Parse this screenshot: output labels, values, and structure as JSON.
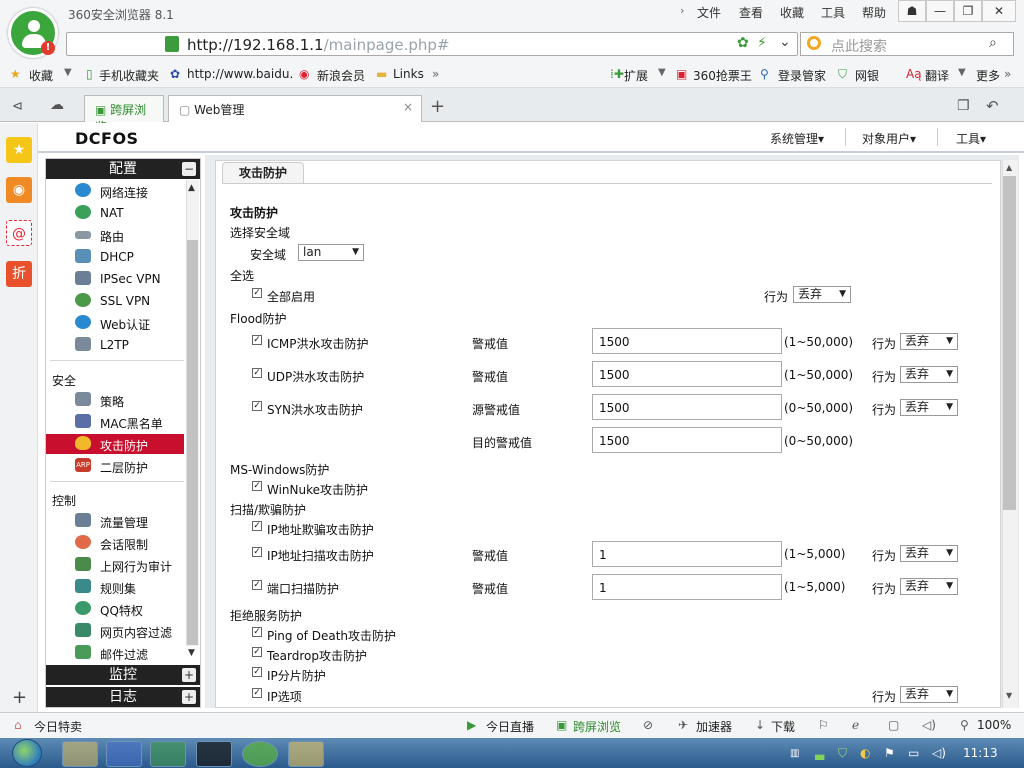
{
  "window": {
    "app_title": "360安全浏览器 8.1",
    "menus": [
      "文件",
      "查看",
      "收藏",
      "工具",
      "帮助"
    ],
    "min_glyph": "—",
    "max_glyph": "❐",
    "close_glyph": "✕"
  },
  "address_bar": {
    "url_host": "http://192.168.1.1",
    "url_path": "/mainpage.php#",
    "search_placeholder": "点此搜索"
  },
  "bookmarks": {
    "items": [
      "收藏",
      "手机收藏夹",
      "http://www.baidu.",
      "新浪会员",
      "Links"
    ],
    "right_items": [
      "扩展",
      "360抢票王",
      "登录管家",
      "网银",
      "翻译",
      "更多"
    ]
  },
  "tabs": {
    "items": [
      "跨屏浏览",
      "Web管理"
    ]
  },
  "app": {
    "logo": "DCFOS",
    "menus": [
      "系统管理▾",
      "对象用户▾",
      "工具▾"
    ]
  },
  "nav": {
    "sections": {
      "config": "配置",
      "monitor": "监控",
      "log": "日志"
    },
    "config_items": [
      "网络连接",
      "NAT",
      "路由",
      "DHCP",
      "IPSec VPN",
      "SSL VPN",
      "Web认证",
      "L2TP"
    ],
    "security_label": "安全",
    "security_items": [
      "策略",
      "MAC黑名单",
      "攻击防护",
      "二层防护"
    ],
    "control_label": "控制",
    "control_items": [
      "流量管理",
      "会话限制",
      "上网行为审计",
      "规则集",
      "QQ特权",
      "网页内容过滤",
      "邮件过滤"
    ],
    "plus": "+",
    "minus": "−"
  },
  "content": {
    "tab_label": "攻击防护",
    "heading": "攻击防护",
    "zone_section": "选择安全域",
    "zone_label": "安全域",
    "zone_value": "lan",
    "select_all_section": "全选",
    "enable_all": "全部启用",
    "action_label": "行为",
    "action_value": "丢弃",
    "flood_section": "Flood防护",
    "icmp": "ICMP洪水攻击防护",
    "udp": "UDP洪水攻击防护",
    "syn": "SYN洪水攻击防护",
    "alarm_label": "警戒值",
    "src_alarm_label": "源警戒值",
    "dst_alarm_label": "目的警戒值",
    "flood_value": "1500",
    "range_50000_a": "(1~50,000)",
    "range_50000_b": "(0~50,000)",
    "mswin_section": "MS-Windows防护",
    "winnuke": "WinNuke攻击防护",
    "scan_section": "扫描/欺骗防护",
    "ip_spoof": "IP地址欺骗攻击防护",
    "ip_scan": "IP地址扫描攻击防护",
    "port_scan": "端口扫描防护",
    "scan_value": "1",
    "range_5000": "(1~5,000)",
    "dos_section": "拒绝服务防护",
    "ping_death": "Ping of Death攻击防护",
    "teardrop": "Teardrop攻击防护",
    "ip_frag": "IP分片防护",
    "ip_option": "IP选项",
    "check": "✓",
    "down": "▼"
  },
  "status_bar": {
    "left": "今日特卖",
    "items": [
      "今日直播",
      "跨屏浏览",
      "加速器",
      "下载"
    ],
    "zoom": "100%"
  },
  "taskbar": {
    "time": "11:13"
  }
}
